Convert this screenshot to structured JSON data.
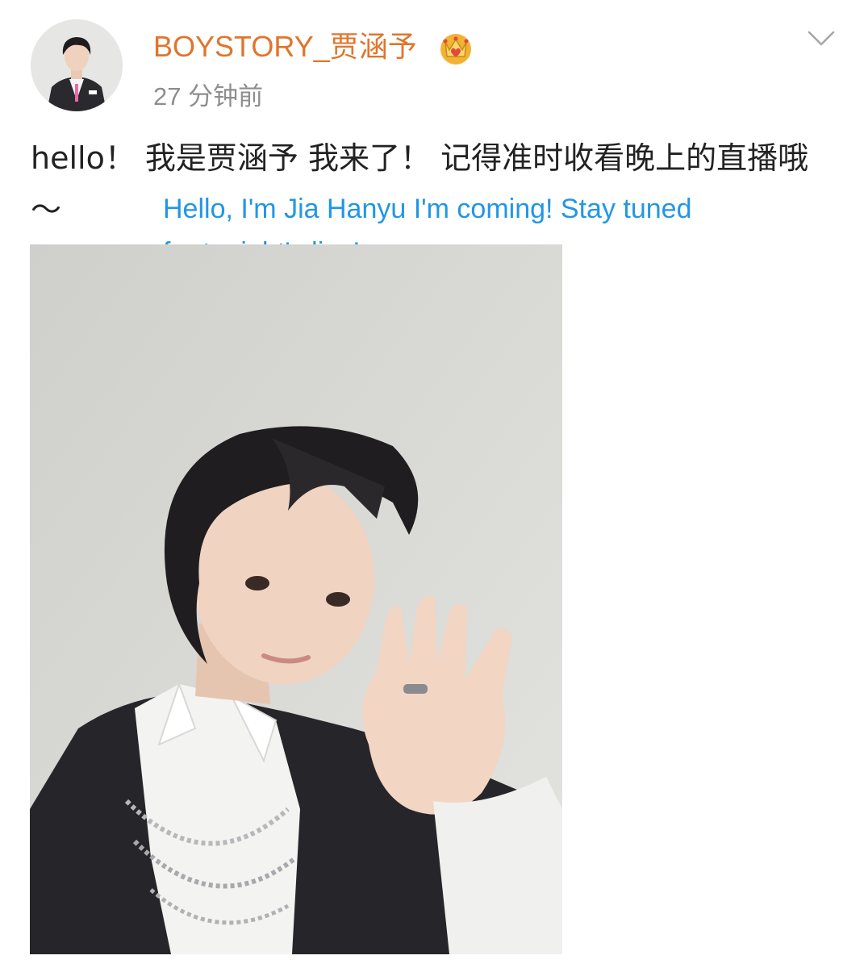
{
  "post": {
    "author": {
      "username": "BOYSTORY_贾涵予",
      "badge_icon": "crown-badge-icon",
      "avatar_icon": "avatar-photo"
    },
    "timestamp": "27 分钟前",
    "menu_icon": "chevron-down-icon",
    "text": "hello！ 我是贾涵予 我来了！ 记得准时收看晚上的直播哦～",
    "translation": "Hello, I'm Jia Hanyu I'm coming! Stay tuned for tonight's live!",
    "image_icon": "selfie-photo"
  },
  "colors": {
    "username": "#e0752c",
    "timestamp": "#8e8e8e",
    "text": "#222222",
    "translation": "#2196e6",
    "badge_gold": "#f2b233",
    "badge_red": "#e2483b"
  }
}
